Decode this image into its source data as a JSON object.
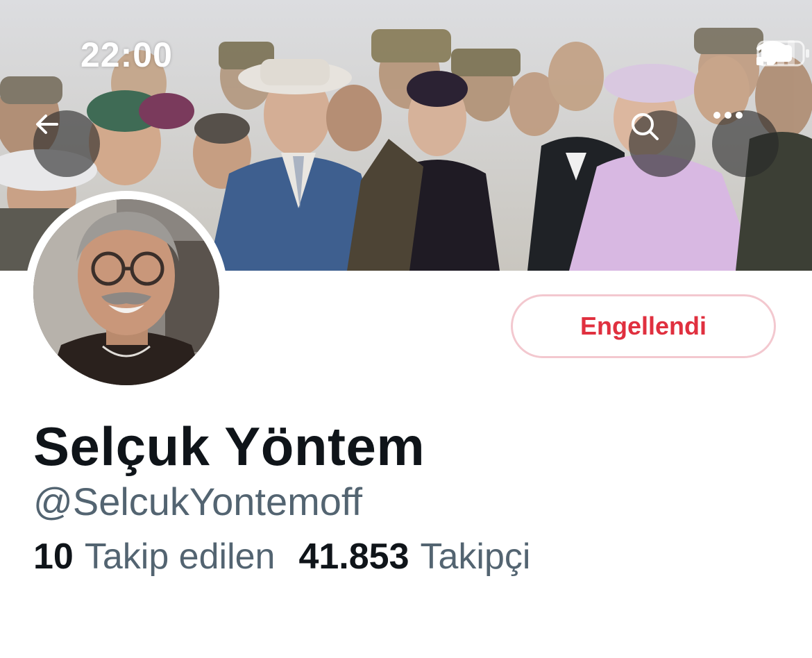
{
  "status_bar": {
    "time": "22:00"
  },
  "header": {
    "back_icon": "arrow-left-icon",
    "search_icon": "search-icon",
    "more_icon": "more-horizontal-icon"
  },
  "profile": {
    "display_name": "Selçuk Yöntem",
    "handle": "@SelcukYontemoff",
    "blocked_label": "Engellendi",
    "stats": {
      "following_count": "10",
      "following_label": "Takip edilen",
      "followers_count": "41.853",
      "followers_label": "Takipçi"
    }
  },
  "colors": {
    "blocked_text": "#e0303f",
    "blocked_border": "#f3c8cf",
    "name_text": "#0f1419",
    "secondary_text": "#536471"
  }
}
